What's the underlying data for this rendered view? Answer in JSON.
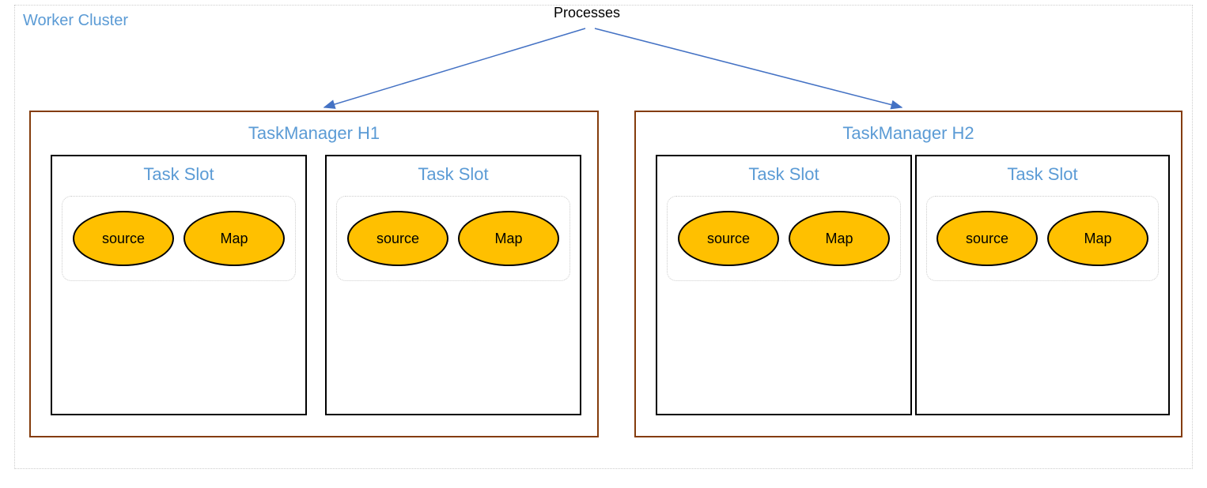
{
  "cluster": {
    "label": "Worker Cluster",
    "processes_label": "Processes"
  },
  "task_managers": [
    {
      "title": "TaskManager H1",
      "slots": [
        {
          "title": "Task Slot",
          "ops": [
            {
              "label": "source"
            },
            {
              "label": "Map"
            }
          ]
        },
        {
          "title": "Task Slot",
          "ops": [
            {
              "label": "source"
            },
            {
              "label": "Map"
            }
          ]
        }
      ]
    },
    {
      "title": "TaskManager H2",
      "slots": [
        {
          "title": "Task Slot",
          "ops": [
            {
              "label": "source"
            },
            {
              "label": "Map"
            }
          ]
        },
        {
          "title": "Task Slot",
          "ops": [
            {
              "label": "source"
            },
            {
              "label": "Map"
            }
          ]
        }
      ]
    }
  ]
}
